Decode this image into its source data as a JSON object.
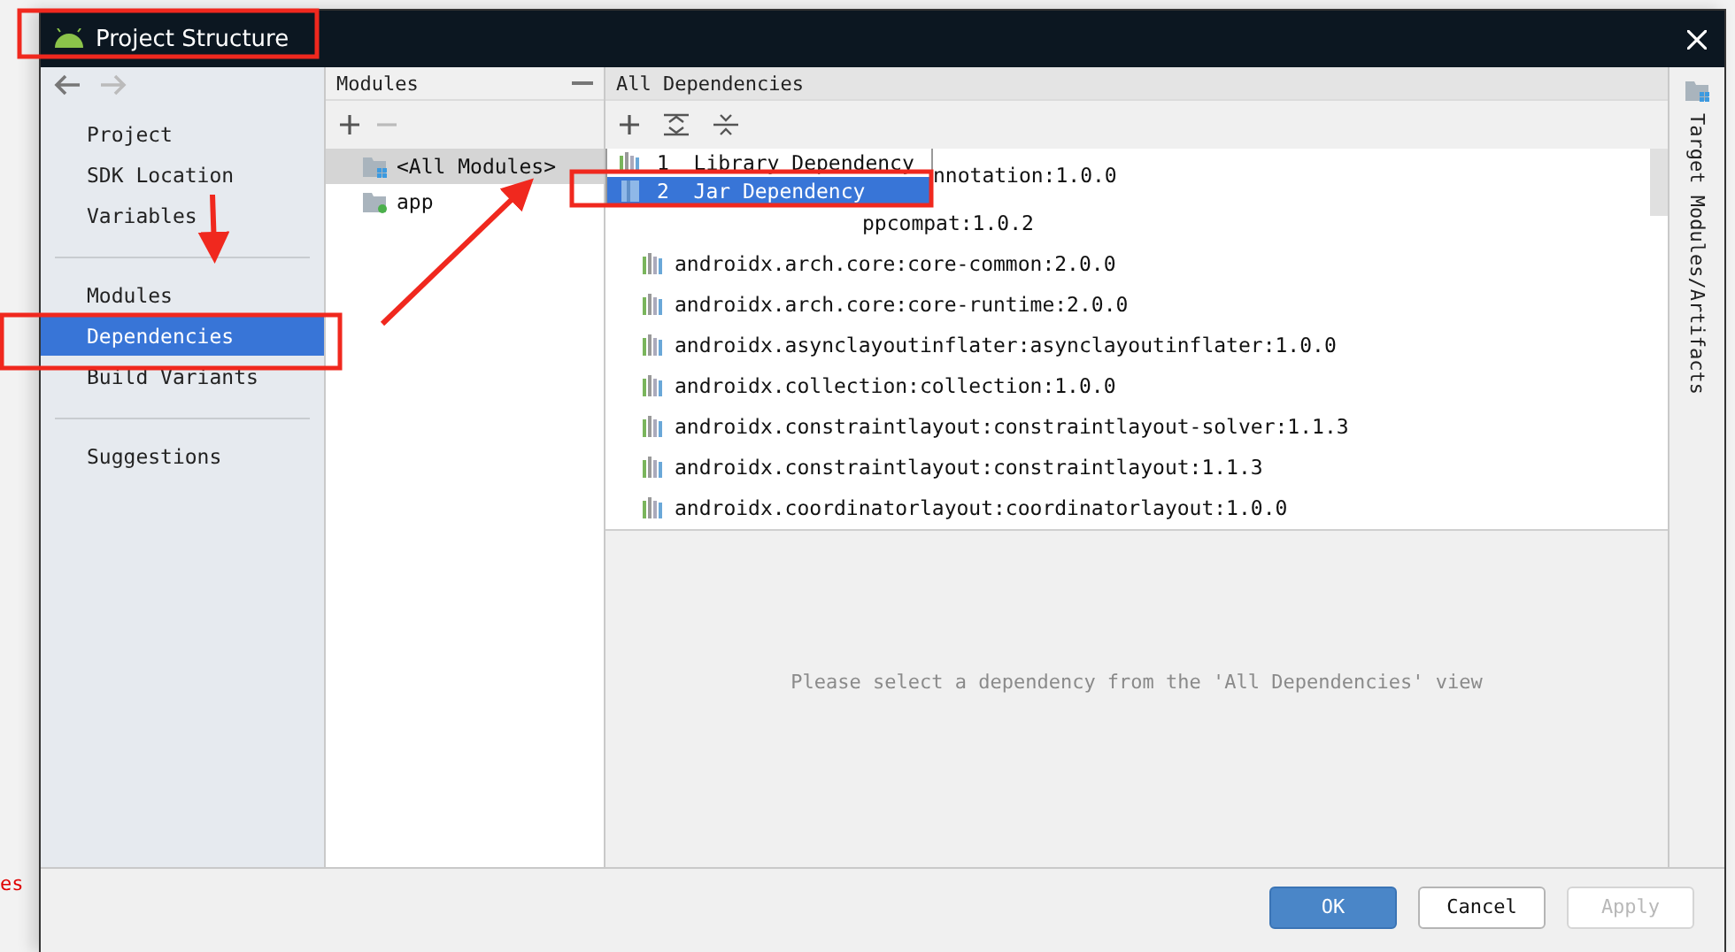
{
  "window": {
    "title": "Project Structure"
  },
  "background": {
    "text": "es"
  },
  "sidebar": {
    "groups": [
      [
        {
          "label": "Project",
          "selected": false
        },
        {
          "label": "SDK Location",
          "selected": false
        },
        {
          "label": "Variables",
          "selected": false
        }
      ],
      [
        {
          "label": "Modules",
          "selected": false
        },
        {
          "label": "Dependencies",
          "selected": true
        },
        {
          "label": "Build Variants",
          "selected": false
        }
      ],
      [
        {
          "label": "Suggestions",
          "selected": false
        }
      ]
    ]
  },
  "modules_panel": {
    "title": "Modules",
    "items": [
      {
        "label": "<All Modules>",
        "selected": true,
        "kind": "all"
      },
      {
        "label": "app",
        "selected": false,
        "kind": "module"
      }
    ]
  },
  "dependencies_panel": {
    "title": "All Dependencies",
    "add_menu": {
      "items": [
        {
          "number": "1",
          "label": "Library Dependency",
          "selected": false,
          "kind": "library"
        },
        {
          "number": "2",
          "label": "Jar Dependency",
          "selected": true,
          "kind": "jar"
        }
      ]
    },
    "rows": [
      {
        "text": "nnotation:1.0.0",
        "kind": "under_menu"
      },
      {
        "text": "ppcompat:1.0.2",
        "kind": "under_menu"
      },
      {
        "text": "androidx.arch.core:core-common:2.0.0",
        "kind": "full"
      },
      {
        "text": "androidx.arch.core:core-runtime:2.0.0",
        "kind": "full"
      },
      {
        "text": "androidx.asynclayoutinflater:asynclayoutinflater:1.0.0",
        "kind": "full"
      },
      {
        "text": "androidx.collection:collection:1.0.0",
        "kind": "full"
      },
      {
        "text": "androidx.constraintlayout:constraintlayout-solver:1.1.3",
        "kind": "full"
      },
      {
        "text": "androidx.constraintlayout:constraintlayout:1.1.3",
        "kind": "full"
      },
      {
        "text": "androidx.coordinatorlayout:coordinatorlayout:1.0.0",
        "kind": "full"
      }
    ],
    "detail_message": "Please select a dependency from the 'All Dependencies' view"
  },
  "side_tab": {
    "label": "Target Modules/Artifacts"
  },
  "buttons": [
    {
      "label": "OK",
      "kind": "primary",
      "disabled": false
    },
    {
      "label": "Cancel",
      "kind": "default",
      "disabled": false
    },
    {
      "label": "Apply",
      "kind": "default",
      "disabled": true
    }
  ]
}
